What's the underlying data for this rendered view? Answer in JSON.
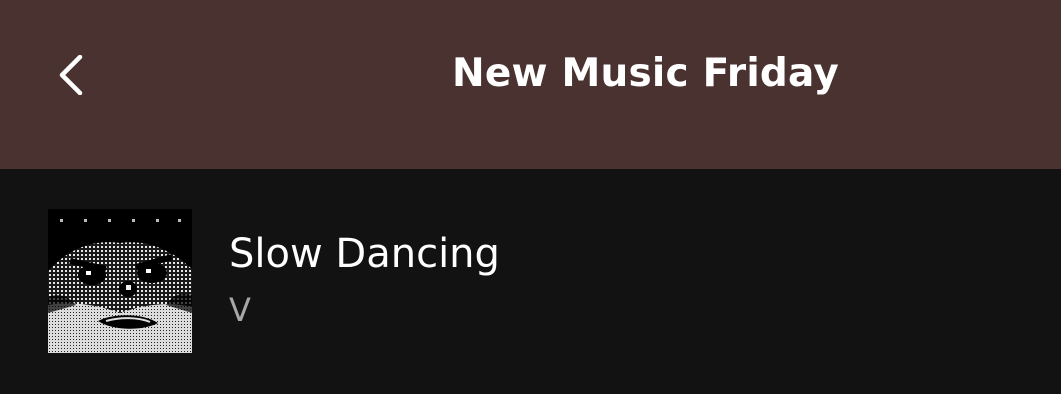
{
  "header": {
    "back_icon": "chevron-left-icon",
    "title": "New Music Friday",
    "background_color": "#4a3231"
  },
  "track": {
    "title": "Slow Dancing",
    "artist": "V",
    "album_art": "album-cover"
  },
  "colors": {
    "page_background": "#121212",
    "primary_text": "#ffffff",
    "secondary_text": "#a7a7a7"
  }
}
